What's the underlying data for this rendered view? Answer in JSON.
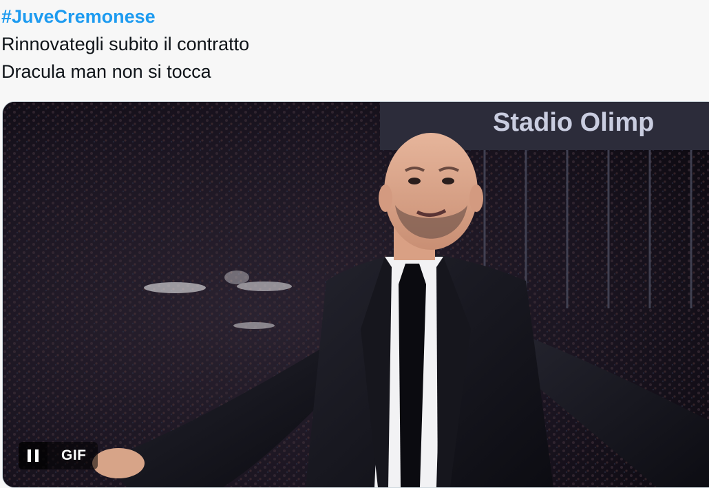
{
  "tweet": {
    "hashtag": "#JuveCremonese",
    "line1": "Rinnovategli subito il contratto",
    "line2": "Dracula man non si tocca"
  },
  "media": {
    "type": "gif",
    "stadium_sign": "Stadio Olimp",
    "badge_label": "GIF",
    "pause_icon": "pause-icon"
  },
  "colors": {
    "hashtag": "#1d9bf0",
    "text": "#0f1419",
    "background": "#f7f7f7"
  }
}
